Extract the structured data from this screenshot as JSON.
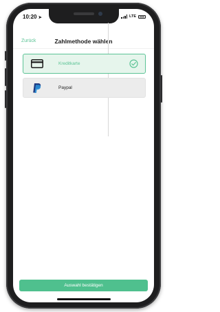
{
  "status_bar": {
    "time": "10:20",
    "network": "LTE"
  },
  "nav": {
    "back_label": "Zurück",
    "title": "Zahlmethode wählen"
  },
  "payment_options": [
    {
      "label": "Kreditkarte",
      "icon": "credit-card-icon",
      "selected": true
    },
    {
      "label": "Paypal",
      "icon": "paypal-icon",
      "selected": false
    }
  ],
  "confirm_button": {
    "label": "Auswahl bestätigen"
  },
  "colors": {
    "accent": "#5bc395",
    "button": "#4fc08e",
    "selected_bg": "#e6f5ec",
    "unselected_bg": "#ececec",
    "frame": "#1e1e1f"
  }
}
